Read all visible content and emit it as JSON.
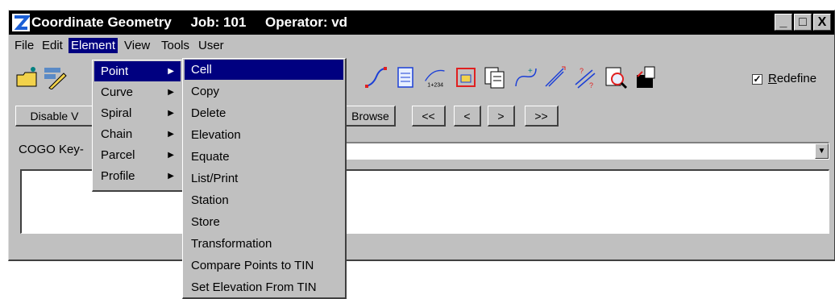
{
  "titlebar": {
    "app": "Coordinate Geometry",
    "job": "Job: 101",
    "operator": "Operator: vd",
    "minimize": "_",
    "maximize": "□",
    "close": "X"
  },
  "menubar": {
    "file": "File",
    "edit": "Edit",
    "element": "Element",
    "view": "View",
    "tools": "Tools",
    "user": "User"
  },
  "toolbar": {
    "redefine_label": "Redefine",
    "redefine_checked": "✓",
    "station_label": "1+234"
  },
  "buttons": {
    "disable": "Disable V",
    "browse": "Browse",
    "first": "<<",
    "prev": "<",
    "next": ">",
    "last": ">>"
  },
  "keyin": {
    "label": "COGO Key-",
    "dropdown_arrow": "▼"
  },
  "element_menu": {
    "point": "Point",
    "curve": "Curve",
    "spiral": "Spiral",
    "chain": "Chain",
    "parcel": "Parcel",
    "profile": "Profile",
    "submenu_arrow": "▶"
  },
  "point_menu": {
    "cell": "Cell",
    "copy": "Copy",
    "delete": "Delete",
    "elevation": "Elevation",
    "equate": "Equate",
    "list_print": "List/Print",
    "station": "Station",
    "store": "Store",
    "transformation": "Transformation",
    "compare_points_to_tin": "Compare Points to TIN",
    "set_elevation_from_tin": "Set Elevation From TIN"
  },
  "colors": {
    "titlebar": "#000000",
    "highlight": "#000080",
    "window_face": "#c0c0c0"
  }
}
